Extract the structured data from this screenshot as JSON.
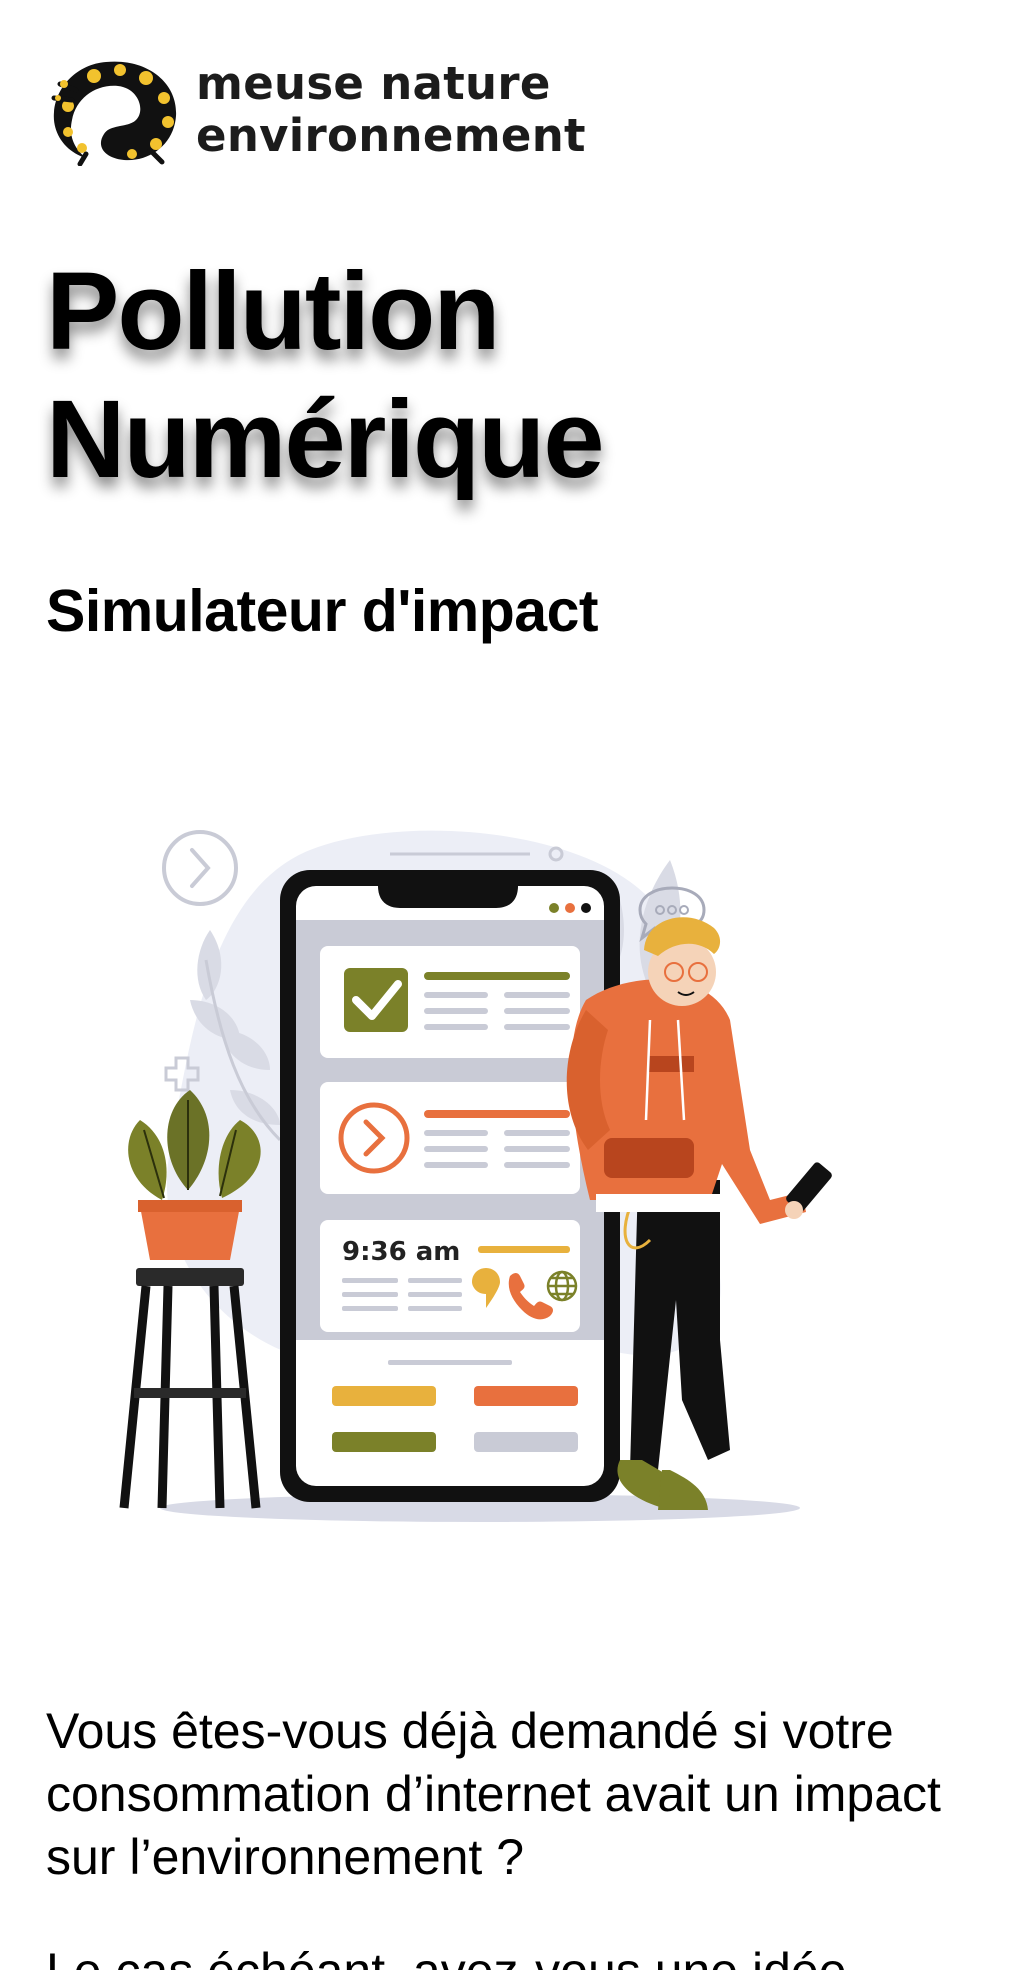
{
  "logo": {
    "line1": "meuse nature",
    "line2": "environnement",
    "icon": "salamander-icon",
    "colors": {
      "yellow": "#f2c22e",
      "black": "#111111"
    }
  },
  "title": {
    "line1": "Pollution",
    "line2": "Numérique"
  },
  "subtitle": "Simulateur d'impact",
  "illustration": {
    "time_label": "9:36 am",
    "colors": {
      "olive": "#7b8129",
      "orange": "#e8703e",
      "yellow": "#e8b13d",
      "gray": "#c9cbd6",
      "dark": "#111111"
    }
  },
  "intro": "Vous êtes-vous déjà demandé si votre consommation d’internet avait un impact sur l’environnement ?",
  "next_paragraph": "Le cas échéant, avez-vous une idée"
}
